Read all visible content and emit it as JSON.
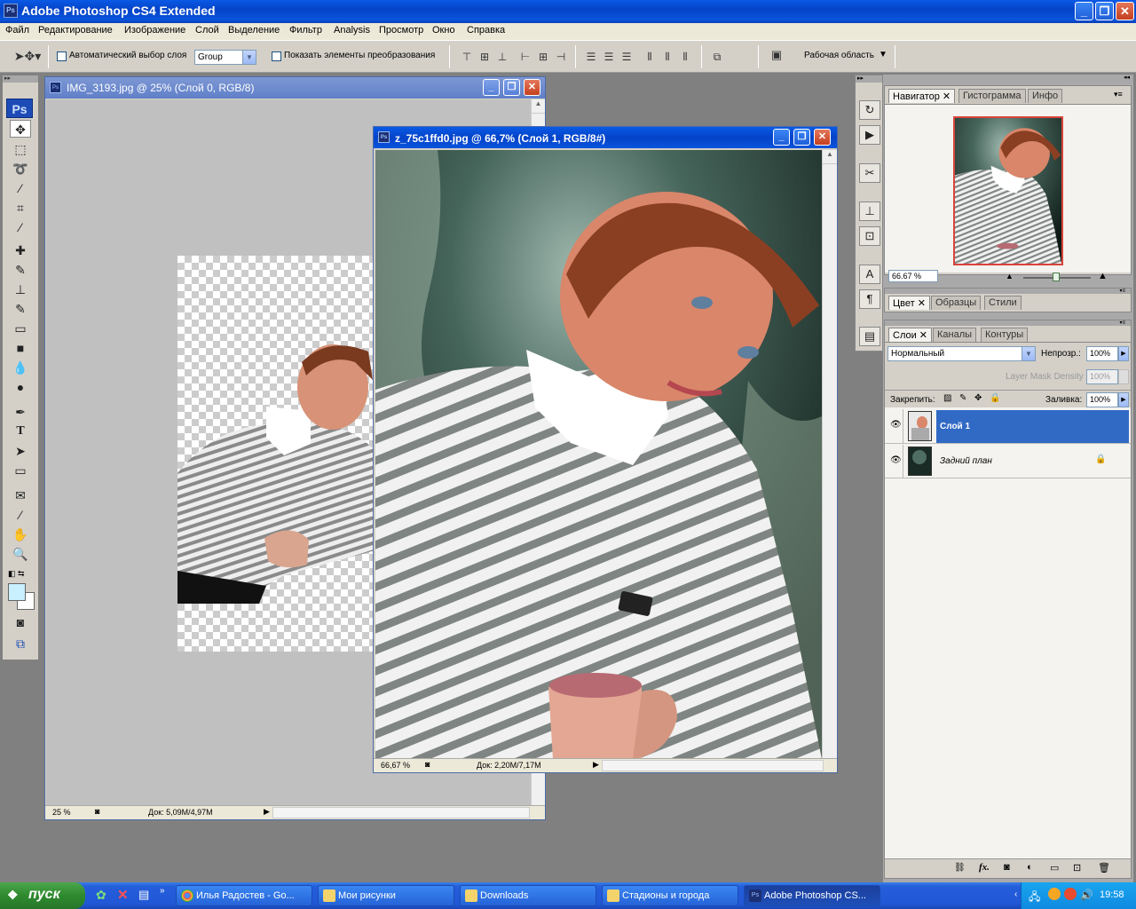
{
  "app": {
    "title": "Adobe Photoshop CS4 Extended",
    "ps_badge": "Ps"
  },
  "menu": [
    "Файл",
    "Редактирование",
    "Изображение",
    "Слой",
    "Выделение",
    "Фильтр",
    "Analysis",
    "Просмотр",
    "Окно",
    "Справка"
  ],
  "options": {
    "auto_select_label": "Автоматический выбор слоя",
    "auto_select_value": "Group",
    "show_transform_label": "Показать элементы преобразования",
    "workspace_label": "Рабочая область"
  },
  "tools": {
    "logo": "Ps"
  },
  "doc1": {
    "title": "IMG_3193.jpg @ 25% (Слой 0, RGB/8)",
    "zoom": "25 %",
    "doc_info": "Док: 5,09M/4,97M"
  },
  "doc2": {
    "title": "z_75c1ffd0.jpg @ 66,7% (Слой 1, RGB/8#)",
    "zoom": "66,67 %",
    "doc_info": "Док: 2,20M/7,17M"
  },
  "navigator": {
    "tabs": [
      "Навигатор",
      "Гистограмма",
      "Инфо"
    ],
    "zoom": "66.67 %"
  },
  "color_panel": {
    "tabs": [
      "Цвет",
      "Образцы",
      "Стили"
    ]
  },
  "layers_panel": {
    "tabs": [
      "Слои",
      "Каналы",
      "Контуры"
    ],
    "blend_mode": "Нормальный",
    "opacity_label": "Непрозр.:",
    "opacity": "100%",
    "mask_density_label": "Layer Mask Density",
    "mask_density": "100%",
    "lock_label": "Закрепить:",
    "fill_label": "Заливка:",
    "fill": "100%",
    "layers": [
      {
        "name": "Слой 1",
        "selected": true
      },
      {
        "name": "Задний план",
        "selected": false
      }
    ]
  },
  "taskbar": {
    "start": "пуск",
    "items": [
      "Илья Радостев - Go...",
      "Мои рисунки",
      "Downloads",
      "Стадионы и города",
      "Adobe Photoshop CS..."
    ],
    "clock": "19:58"
  },
  "colors": {
    "xp_blue": "#0a54dd",
    "selected_layer": "#316ac5",
    "panel_bg": "#d4d0c8"
  }
}
